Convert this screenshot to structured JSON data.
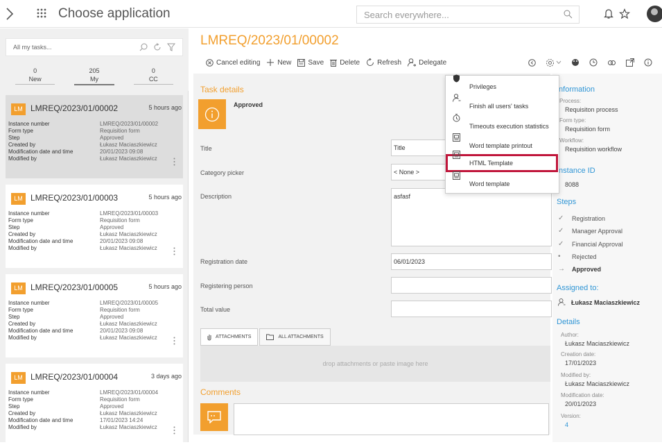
{
  "topbar": {
    "title": "Choose application",
    "search_placeholder": "Search everywhere..."
  },
  "left": {
    "search_placeholder": "All my tasks...",
    "counts": [
      {
        "num": "0",
        "label": "New"
      },
      {
        "num": "205",
        "label": "My"
      },
      {
        "num": "0",
        "label": "CC"
      }
    ],
    "row_keys": [
      "Instance number",
      "Form type",
      "Step",
      "Created by",
      "Modification date and time",
      "Modified by"
    ],
    "cards": [
      {
        "badge": "LM",
        "id": "LMREQ/2023/01/00002",
        "ago": "5 hours ago",
        "vals": [
          "LMREQ/2023/01/00002",
          "Requisition form",
          "Approved",
          "Łukasz Maciaszkiewicz",
          "20/01/2023 09:08",
          "Łukasz Maciaszkiewicz"
        ]
      },
      {
        "badge": "LM",
        "id": "LMREQ/2023/01/00003",
        "ago": "5 hours ago",
        "vals": [
          "LMREQ/2023/01/00003",
          "Requisition form",
          "Approved",
          "Łukasz Maciaszkiewicz",
          "20/01/2023 09:08",
          "Łukasz Maciaszkiewicz"
        ]
      },
      {
        "badge": "LM",
        "id": "LMREQ/2023/01/00005",
        "ago": "5 hours ago",
        "vals": [
          "LMREQ/2023/01/00005",
          "Requisition form",
          "Approved",
          "Łukasz Maciaszkiewicz",
          "20/01/2023 09:08",
          "Łukasz Maciaszkiewicz"
        ]
      },
      {
        "badge": "LM",
        "id": "LMREQ/2023/01/00004",
        "ago": "3 days ago",
        "vals": [
          "LMREQ/2023/01/00004",
          "Requisition form",
          "Approved",
          "Łukasz Maciaszkiewicz",
          "17/01/2023 14:24",
          "Łukasz Maciaszkiewicz"
        ]
      }
    ]
  },
  "main": {
    "title": "LMREQ/2023/01/00002",
    "toolbar": {
      "cancel": "Cancel editing",
      "new": "New",
      "save": "Save",
      "delete": "Delete",
      "refresh": "Refresh",
      "delegate": "Delegate"
    },
    "section": "Task details",
    "status": "Approved",
    "fields": [
      {
        "label": "Title",
        "value": "Title"
      },
      {
        "label": "Category picker",
        "value": "< None >"
      },
      {
        "label": "Description",
        "value": "asfasf"
      },
      {
        "label": "Registration date",
        "value": "06/01/2023"
      },
      {
        "label": "Registering person",
        "value": ""
      },
      {
        "label": "Total value",
        "value": ""
      }
    ],
    "tabs": [
      "ATTACHMENTS",
      "ALL ATTACHMENTS"
    ],
    "drop_text": "drop attachments or paste image here",
    "comments_title": "Comments"
  },
  "menu": {
    "items": [
      "Privileges",
      "Finish all users' tasks",
      "Timeouts execution statistics",
      "Word template printout",
      "HTML Template",
      "Word template"
    ]
  },
  "info": {
    "heading": "Information",
    "process_k": "Process:",
    "process_v": "Requisiton process",
    "form_k": "Form type:",
    "form_v": "Requisition form",
    "workflow_k": "Workflow:",
    "workflow_v": "Requisition workflow",
    "instance_h": "Instance ID",
    "instance_v": "8088",
    "steps_h": "Steps",
    "steps": [
      "Registration",
      "Manager Approval",
      "Financial Approval",
      "Rejected",
      "Approved"
    ],
    "assigned_h": "Assigned to:",
    "assigned_v": "Łukasz Maciaszkiewicz",
    "details_h": "Details",
    "author_k": "Author:",
    "author_v": "Łukasz Maciaszkiewicz",
    "created_k": "Creation date:",
    "created_v": "17/01/2023",
    "modby_k": "Modified by:",
    "modby_v": "Łukasz Maciaszkiewicz",
    "moddate_k": "Modification date:",
    "moddate_v": "20/01/2023",
    "version_k": "Version:",
    "version_v": "4"
  },
  "colors": {
    "accent": "#f29f2e",
    "link": "#2f95d5",
    "highlight": "#c0163b"
  }
}
